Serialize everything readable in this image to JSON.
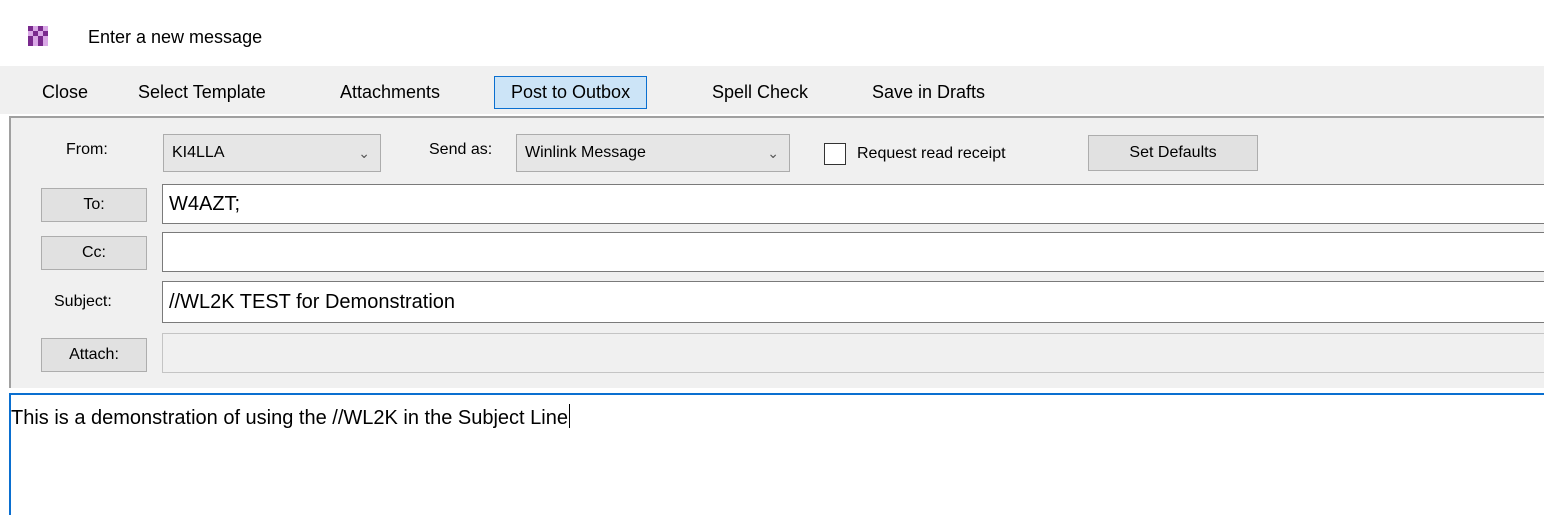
{
  "window": {
    "title": "Enter a new message",
    "icon": "winlink-checkered-icon"
  },
  "menu": {
    "items": [
      {
        "label": "Close"
      },
      {
        "label": "Select Template"
      },
      {
        "label": "Attachments"
      },
      {
        "label": "Post to Outbox",
        "active": true
      },
      {
        "label": "Spell Check"
      },
      {
        "label": "Save in Drafts"
      }
    ]
  },
  "form": {
    "from_label": "From:",
    "from_value": "KI4LLA",
    "send_as_label": "Send as:",
    "send_as_value": "Winlink Message",
    "read_receipt_label": "Request read receipt",
    "read_receipt_checked": false,
    "set_defaults_label": "Set Defaults",
    "to_label": "To:",
    "to_value": "W4AZT;",
    "cc_label": "Cc:",
    "cc_value": "",
    "subject_label": "Subject:",
    "subject_value": "//WL2K TEST for Demonstration",
    "attach_label": "Attach:",
    "attach_value": ""
  },
  "body": {
    "text": "This is a demonstration of using the //WL2K in the Subject Line"
  },
  "colors": {
    "accent": "#0a6fd0",
    "active_menu_bg": "#cce4f7",
    "icon_purple": "#7a2a8e"
  }
}
